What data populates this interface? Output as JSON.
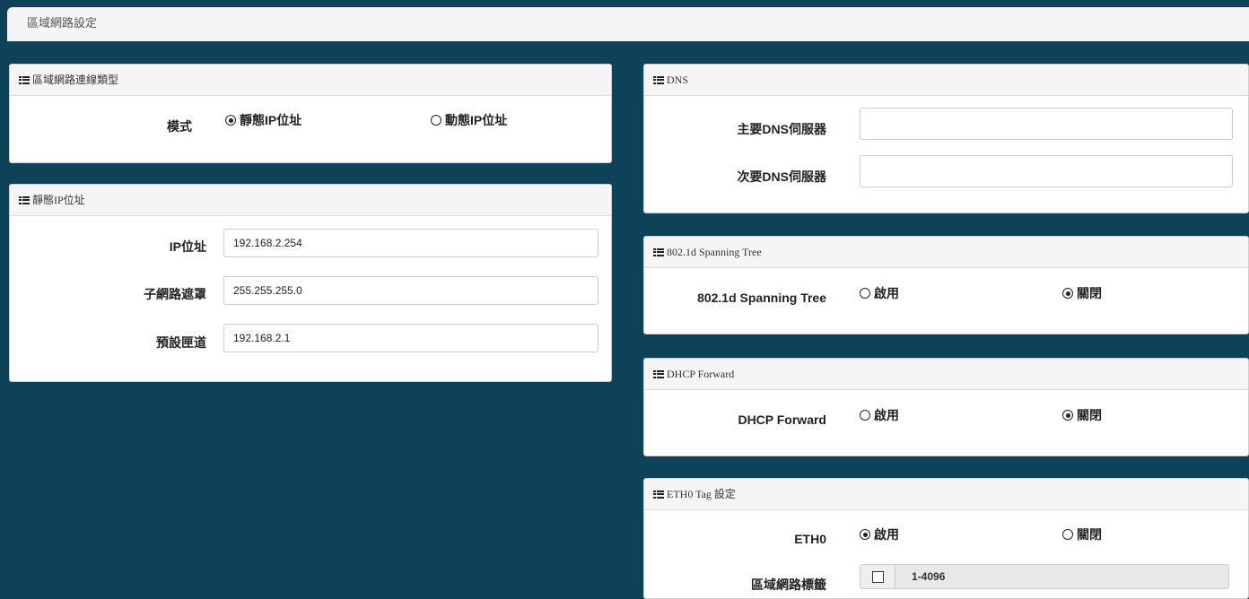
{
  "title": "區域網路設定",
  "connection_type": {
    "header": "區域網路連線類型",
    "mode_label": "模式",
    "options": [
      "靜態IP位址",
      "動態IP位址"
    ]
  },
  "static_ip": {
    "header": "靜態IP位址",
    "ip_label": "IP位址",
    "ip_value": "192.168.2.254",
    "mask_label": "子網路遮罩",
    "mask_value": "255.255.255.0",
    "gateway_label": "預設匣道",
    "gateway_value": "192.168.2.1"
  },
  "dns": {
    "header": "DNS",
    "primary_label": "主要DNS伺服器",
    "primary_value": "",
    "secondary_label": "次要DNS伺服器",
    "secondary_value": ""
  },
  "stp": {
    "header": "802.1d Spanning Tree",
    "label": "802.1d Spanning Tree",
    "enable": "啟用",
    "disable": "關閉"
  },
  "dhcp": {
    "header": "DHCP Forward",
    "label": "DHCP Forward",
    "enable": "啟用",
    "disable": "關閉"
  },
  "eth0": {
    "header": "ETH0 Tag 設定",
    "label": "ETH0",
    "enable": "啟用",
    "disable": "關閉",
    "vlan_label": "區域網路標籤",
    "vlan_placeholder": "1-4096"
  }
}
